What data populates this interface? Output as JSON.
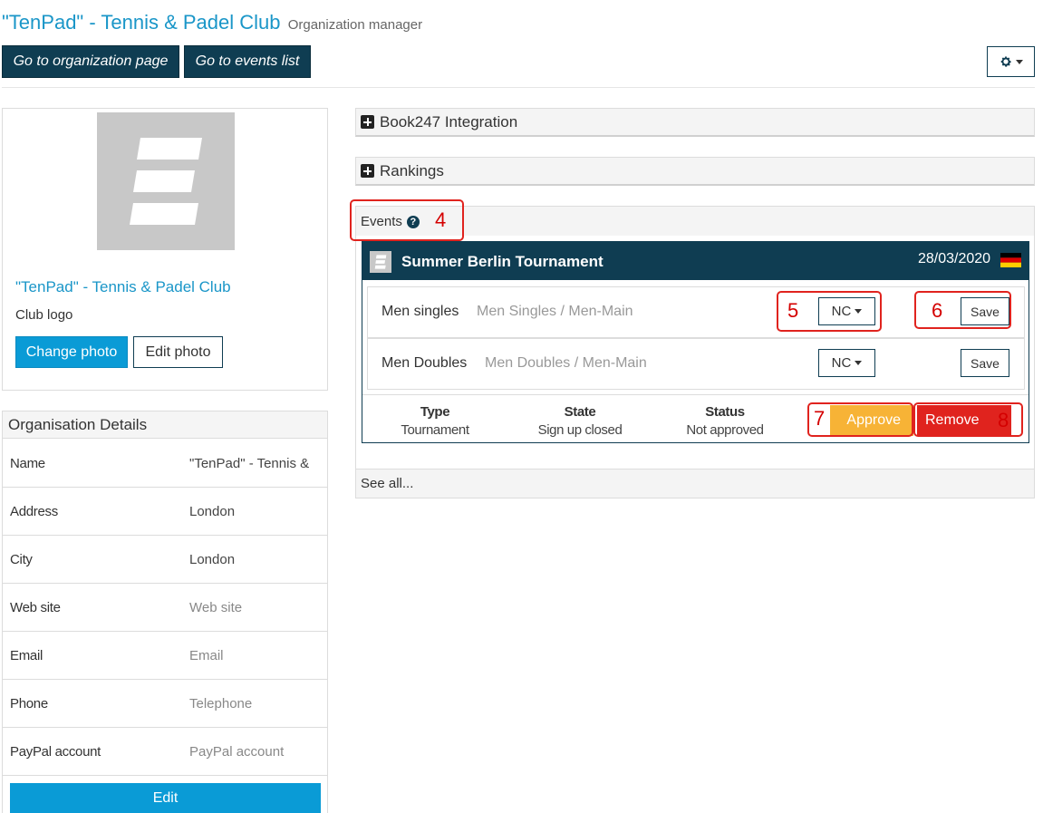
{
  "header": {
    "title": "\"TenPad\" - Tennis & Padel Club",
    "subtitle": "Organization manager",
    "btn_org_page": "Go to organization page",
    "btn_events_list": "Go to events list"
  },
  "profile": {
    "club_name": "\"TenPad\" - Tennis & Padel Club",
    "logo_label": "Club logo",
    "change_photo": "Change photo",
    "edit_photo": "Edit photo"
  },
  "org_details": {
    "title": "Organisation Details",
    "rows": [
      {
        "label": "Name",
        "value": "\"TenPad\" - Tennis & Padel Club"
      },
      {
        "label": "Address",
        "value": "London"
      },
      {
        "label": "City",
        "value": "London"
      },
      {
        "label": "Web site",
        "value": "Web site"
      },
      {
        "label": "Email",
        "value": "Email"
      },
      {
        "label": "Phone",
        "value": "Telephone"
      },
      {
        "label": "PayPal account",
        "value": "PayPal account"
      }
    ],
    "edit_label": "Edit"
  },
  "panels": {
    "book247": "Book247 Integration",
    "rankings": "Rankings"
  },
  "events": {
    "title": "Events",
    "see_all": "See all...",
    "event": {
      "name": "Summer Berlin Tournament",
      "date": "28/03/2020",
      "categories": [
        {
          "name": "Men singles",
          "sub": "Men Singles / Men-Main",
          "level": "NC",
          "save": "Save"
        },
        {
          "name": "Men Doubles",
          "sub": "Men Doubles / Men-Main",
          "level": "NC",
          "save": "Save"
        }
      ],
      "info": {
        "type_label": "Type",
        "type_value": "Tournament",
        "state_label": "State",
        "state_value": "Sign up closed",
        "status_label": "Status",
        "status_value": "Not approved"
      },
      "approve": "Approve",
      "remove": "Remove"
    }
  },
  "annotations": [
    "4",
    "5",
    "6",
    "7",
    "8"
  ],
  "colors": {
    "dark": "#0f3d52",
    "blue": "#0a9bd6",
    "link": "#1a96c8",
    "approve": "#f7b336",
    "remove": "#e0231e"
  }
}
